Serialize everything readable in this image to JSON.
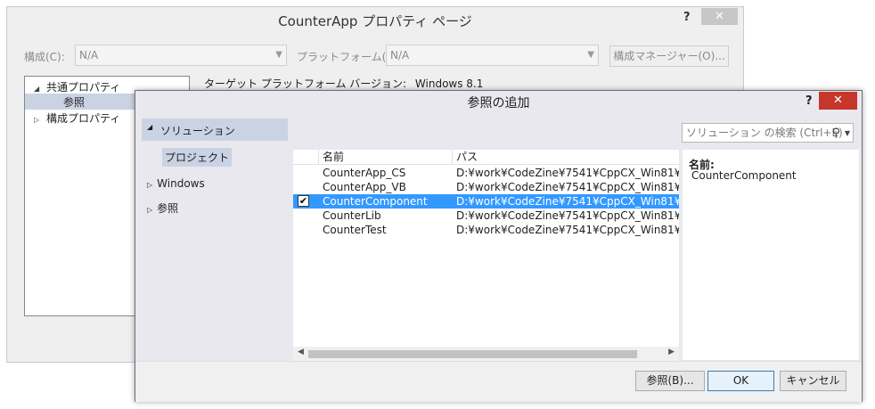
{
  "back_window": {
    "title": "CounterApp プロパティ ページ",
    "help": "?",
    "close": "✕",
    "config_label": "構成(C):",
    "config_value": "N/A",
    "platform_label": "プラットフォーム(P):",
    "platform_value": "N/A",
    "config_manager_button": "構成マネージャー(O)...",
    "tree": [
      {
        "label": "共通プロパティ",
        "tri": "◢"
      },
      {
        "label": "参照",
        "tri": ""
      },
      {
        "label": "構成プロパティ",
        "tri": "▷"
      }
    ],
    "target_platform_label": "ターゲット プラットフォーム バージョン:",
    "target_platform_value": "Windows 8.1"
  },
  "dialog": {
    "title": "参照の追加",
    "help": "?",
    "close": "✕",
    "nav": {
      "solution": "ソリューション",
      "project": "プロジェクト",
      "windows": "Windows",
      "reference": "参照"
    },
    "search_placeholder": "ソリューション の検索 (Ctrl+E)",
    "columns": {
      "name": "名前",
      "path": "パス"
    },
    "rows": [
      {
        "name": "CounterApp_CS",
        "path": "D:¥work¥CodeZine¥7541¥CppCX_Win81¥st",
        "checked": false
      },
      {
        "name": "CounterApp_VB",
        "path": "D:¥work¥CodeZine¥7541¥CppCX_Win81¥st",
        "checked": false
      },
      {
        "name": "CounterComponent",
        "path": "D:¥work¥CodeZine¥7541¥CppCX_Win81¥st",
        "checked": true
      },
      {
        "name": "CounterLib",
        "path": "D:¥work¥CodeZine¥7541¥CppCX_Win81¥st",
        "checked": false
      },
      {
        "name": "CounterTest",
        "path": "D:¥work¥CodeZine¥7541¥CppCX_Win81¥st",
        "checked": false
      }
    ],
    "details": {
      "label": "名前:",
      "value": "CounterComponent"
    },
    "buttons": {
      "browse": "参照(B)...",
      "ok": "OK",
      "cancel": "キャンセル"
    }
  }
}
